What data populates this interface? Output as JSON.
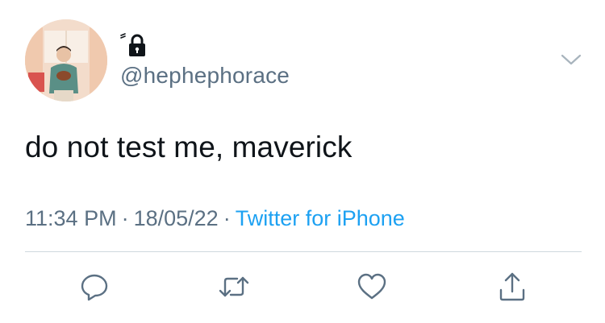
{
  "tweet": {
    "handle": "@hephephorace",
    "text": "do not test me, maverick",
    "time": "11:34 PM",
    "date": "18/05/22",
    "separator": "·",
    "source": "Twitter for iPhone",
    "protected": true
  },
  "icons": {
    "lock": "lock-icon",
    "more": "chevron-down-icon",
    "reply": "reply-icon",
    "retweet": "retweet-icon",
    "like": "like-icon",
    "share": "share-icon"
  },
  "colors": {
    "secondary_text": "#5b7083",
    "link": "#1da1f2",
    "primary_text": "#0f1419",
    "divider": "#cfd9de"
  }
}
